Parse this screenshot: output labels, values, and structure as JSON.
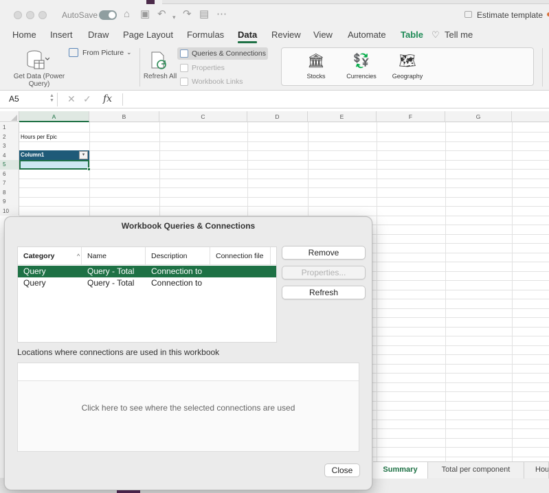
{
  "titlebar": {
    "autosave_label": "AutoSave",
    "document_title": "Estimate template"
  },
  "ribbon_tabs": [
    {
      "label": "Home"
    },
    {
      "label": "Insert"
    },
    {
      "label": "Draw"
    },
    {
      "label": "Page Layout"
    },
    {
      "label": "Formulas"
    },
    {
      "label": "Data",
      "active": true
    },
    {
      "label": "Review"
    },
    {
      "label": "View"
    },
    {
      "label": "Automate"
    },
    {
      "label": "Table",
      "contextual": true
    },
    {
      "label": "Tell me"
    }
  ],
  "ribbon": {
    "get_data": "Get Data (Power Query)",
    "from_picture": "From Picture",
    "refresh_all": "Refresh All",
    "queries_connections": "Queries & Connections",
    "properties": "Properties",
    "workbook_links": "Workbook Links",
    "data_types": [
      {
        "label": "Stocks",
        "icon": "bank-icon"
      },
      {
        "label": "Currencies",
        "icon": "currency-icon"
      },
      {
        "label": "Geography",
        "icon": "map-icon"
      }
    ]
  },
  "formula_bar": {
    "name_box": "A5",
    "fx": "fx",
    "formula": ""
  },
  "grid": {
    "columns": [
      "A",
      "B",
      "C",
      "D",
      "E",
      "F",
      "G"
    ],
    "rows": [
      "1",
      "2",
      "3",
      "4",
      "5",
      "6",
      "7",
      "8",
      "9",
      "10"
    ],
    "cells": {
      "A2": "Hours per Epic",
      "A4": "Column1"
    }
  },
  "sheet_tabs": [
    "Summary",
    "Total per component",
    "Hou"
  ],
  "dialog": {
    "title": "Workbook Queries & Connections",
    "columns": [
      "Category",
      "Name",
      "Description",
      "Connection file"
    ],
    "rows": [
      {
        "category": "Query",
        "name": "Query - Total",
        "description": "Connection to",
        "file": "",
        "selected": true
      },
      {
        "category": "Query",
        "name": "Query - Total",
        "description": "Connection to",
        "file": "",
        "selected": false
      }
    ],
    "buttons": {
      "remove": "Remove",
      "properties": "Properties...",
      "refresh": "Refresh",
      "close": "Close"
    },
    "locations_label": "Locations where connections are used in this workbook",
    "locations_message": "Click here to see where the selected connections are used"
  },
  "colors": {
    "accent": "#1e7145",
    "table_header": "#1e5a78",
    "selected_cell": "#cde8f2"
  }
}
